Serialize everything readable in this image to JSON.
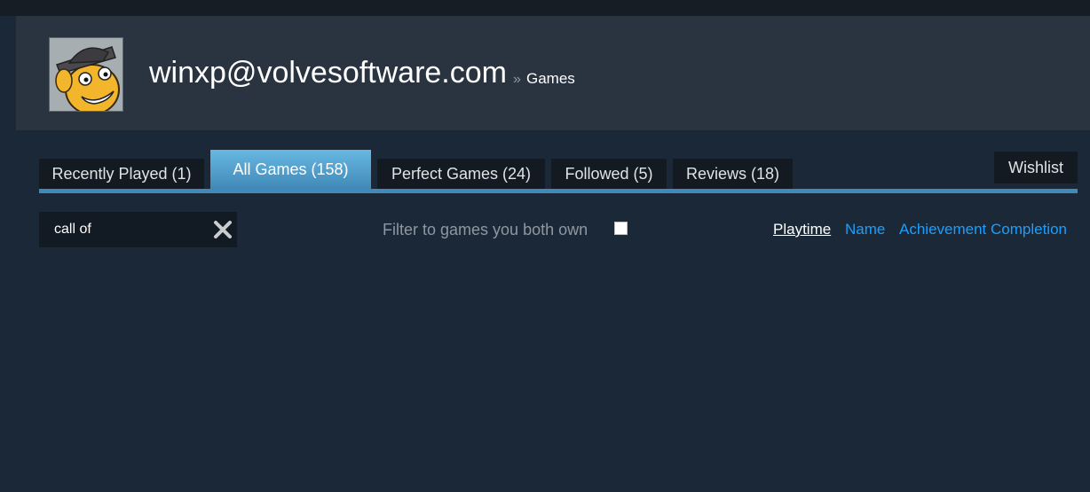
{
  "profile": {
    "name": "winxp@volvesoftware.com",
    "breadcrumb_separator": "»",
    "breadcrumb_current": "Games"
  },
  "tabs": [
    {
      "label": "Recently Played (1)",
      "active": false
    },
    {
      "label": "All Games (158)",
      "active": true
    },
    {
      "label": "Perfect Games (24)",
      "active": false
    },
    {
      "label": "Followed (5)",
      "active": false
    },
    {
      "label": "Reviews (18)",
      "active": false
    }
  ],
  "wishlist_label": "Wishlist",
  "search": {
    "value": "call of",
    "clear_icon": "close-x-icon"
  },
  "filter": {
    "label": "Filter to games you both own",
    "checked": false
  },
  "sort": {
    "options": [
      "Playtime",
      "Name",
      "Achievement Completion"
    ],
    "selected": "Playtime"
  },
  "colors": {
    "background": "#1b2838",
    "header": "#2a3340",
    "accent": "#4189b8",
    "link": "#1a9fff"
  }
}
